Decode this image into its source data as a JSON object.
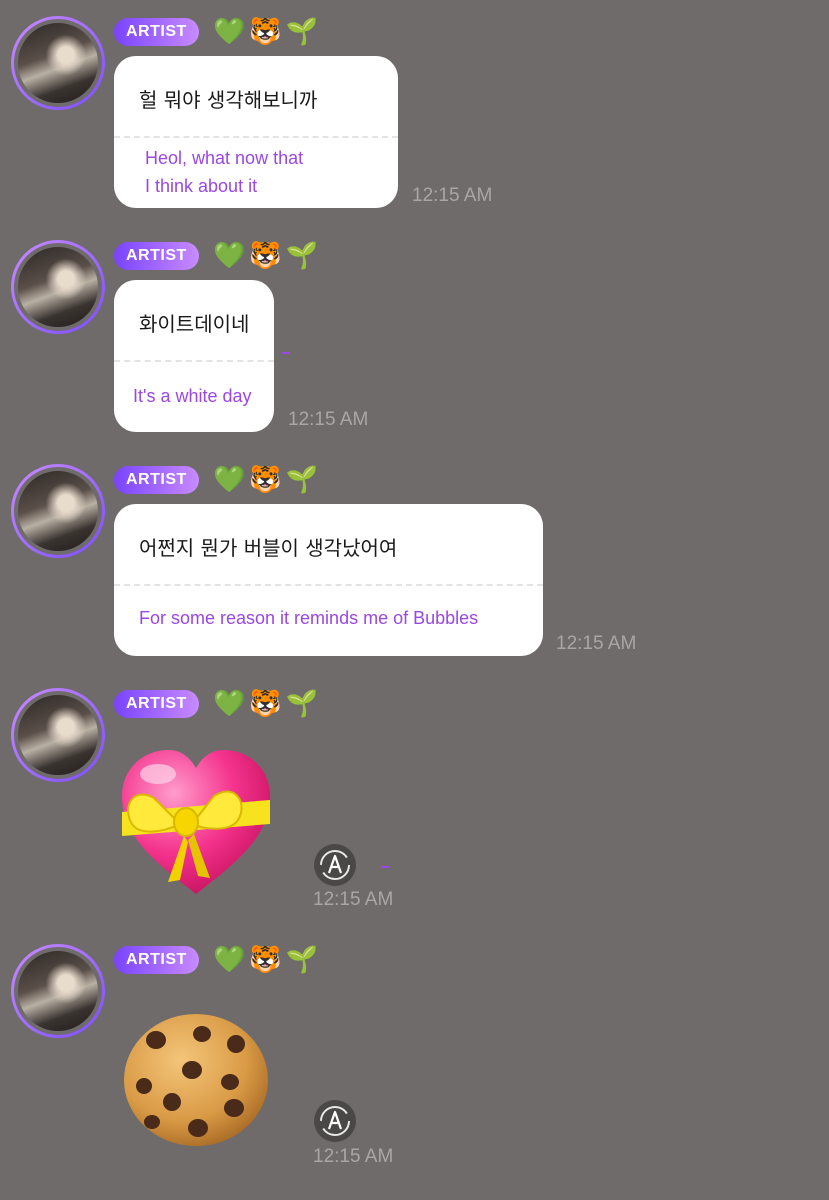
{
  "messages": [
    {
      "badge": "ARTIST",
      "emojis": "💚🐯🌱",
      "korean": "헐 뭐야 생각해보니까",
      "translation_lines": [
        "Heol, what now that",
        "I think about it"
      ],
      "time": "12:15 AM"
    },
    {
      "badge": "ARTIST",
      "emojis": "💚🐯🌱",
      "korean": "화이트데이네",
      "translation_lines": [
        "It's a white day"
      ],
      "time": "12:15 AM"
    },
    {
      "badge": "ARTIST",
      "emojis": "💚🐯🌱",
      "korean": "어쩐지 뭔가 버블이 생각났어여",
      "translation_lines": [
        "For some reason it reminds me of Bubbles"
      ],
      "time": "12:15 AM"
    },
    {
      "badge": "ARTIST",
      "emojis": "💚🐯🌱",
      "sticker": "heart-with-ribbon-emoji",
      "reaction_icon": "auto-translate-icon",
      "time": "12:15 AM"
    },
    {
      "badge": "ARTIST",
      "emojis": "💚🐯🌱",
      "sticker": "cookie-emoji",
      "reaction_icon": "auto-translate-icon",
      "time": "12:15 AM"
    }
  ],
  "colors": {
    "background": "#6f6b6b",
    "badge_start": "#7a43ff",
    "badge_end": "#c88bff",
    "translation_text": "#9a47e6",
    "time_text": "#aaa6a6",
    "bubble": "#ffffff"
  }
}
